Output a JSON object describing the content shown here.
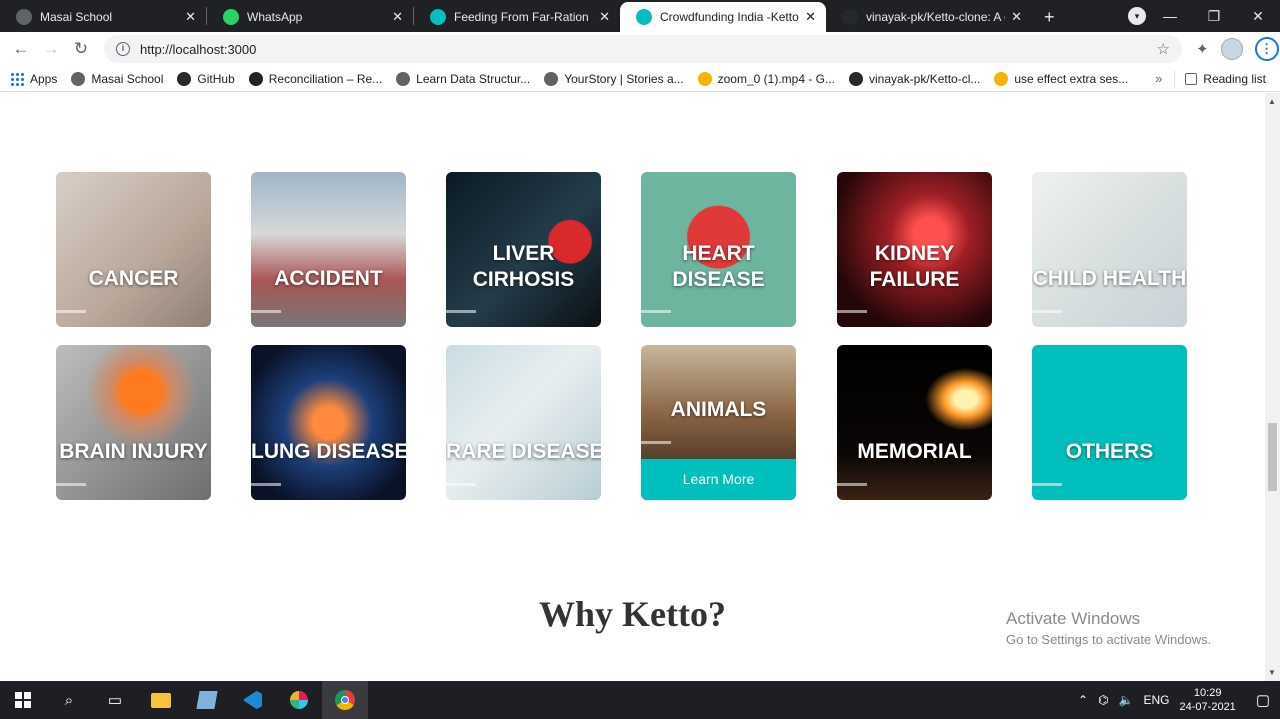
{
  "browser": {
    "tabs": [
      {
        "title": "Masai School",
        "favicon_color": "#5f6368"
      },
      {
        "title": "WhatsApp",
        "favicon_color": "#25d366"
      },
      {
        "title": "Feeding From Far-Ration Dist",
        "favicon_color": "#01bfbd"
      },
      {
        "title": "Crowdfunding India -Ketto",
        "favicon_color": "#01bfbd",
        "active": true
      },
      {
        "title": "vinayak-pk/Ketto-clone: A cl",
        "favicon_color": "#24292e"
      }
    ],
    "new_tab_icon": "plus-icon",
    "url": "http://localhost:3000",
    "bookmarks": [
      {
        "label": "Apps",
        "icon": "apps-grid-icon"
      },
      {
        "label": "Masai School",
        "icon": "globe-icon"
      },
      {
        "label": "GitHub",
        "icon": "github-icon"
      },
      {
        "label": "Reconciliation – Re...",
        "icon": "react-icon"
      },
      {
        "label": "Learn Data Structur...",
        "icon": "globe-icon"
      },
      {
        "label": "YourStory | Stories a...",
        "icon": "globe-icon"
      },
      {
        "label": "zoom_0 (1).mp4 - G...",
        "icon": "drive-icon"
      },
      {
        "label": "vinayak-pk/Ketto-cl...",
        "icon": "github-icon"
      },
      {
        "label": "use effect extra ses...",
        "icon": "drive-icon"
      }
    ],
    "bookmarks_more": "»",
    "reading_list": "Reading list"
  },
  "categories": [
    {
      "label_lines": [
        "CANCER"
      ],
      "bg": "linear-gradient(135deg,#d8cfc6,#b9a79a 60%,#8f7f74)",
      "accent": "#d9857a"
    },
    {
      "label_lines": [
        "ACCIDENT"
      ],
      "bg": "linear-gradient(180deg,#9fb6c9 0%,#d8d8d8 40%,#a55 70%,#777 100%)",
      "accent": "#e05a2b"
    },
    {
      "label_lines": [
        "LIVER",
        "CIRHOSIS"
      ],
      "bg": "radial-gradient(circle at 80% 45%,#d9292d 0 14%,transparent 15%),linear-gradient(135deg,#0a1a22,#243c4a 55%,#0a1015)",
      "accent": "#2f6de0"
    },
    {
      "label_lines": [
        "HEART",
        "DISEASE"
      ],
      "bg": "radial-gradient(circle at 50% 42%,#e0393a 0 26%,transparent 27%),#6eb5a0",
      "accent": "#e0393a"
    },
    {
      "label_lines": [
        "KIDNEY",
        "FAILURE"
      ],
      "bg": "radial-gradient(circle at 60% 40%,#ff5050 0 12%,#9e1f25 30%,#250709 75%)",
      "accent": "#ff5050"
    },
    {
      "label_lines": [
        "CHILD HEALTH"
      ],
      "bg": "linear-gradient(135deg,#eef1f0,#d7dede 55%,#c9d2d8)",
      "accent": "#d8b49a"
    },
    {
      "label_lines": [
        "BRAIN INJURY"
      ],
      "bg": "radial-gradient(circle at 55% 30%,#ff7a1e 0 14%,#d08a66 22%,transparent 40%),linear-gradient(135deg,#bdbdbd,#8e8e8e 60%,#6e6e6e)",
      "accent": "#ff7a1e"
    },
    {
      "label_lines": [
        "LUNG DISEASE"
      ],
      "bg": "radial-gradient(circle at 50% 50%,#ff8a3d 0 14%,#1d3f7a 40%,#0a1228 80%)",
      "accent": "#ff8a3d"
    },
    {
      "label_lines": [
        "RARE DISEASE"
      ],
      "bg": "linear-gradient(135deg,#c9dde3,#e8eef0 45%,#b8cdd4)",
      "accent": "#d8a5a0"
    },
    {
      "label_lines": [
        "ANIMALS"
      ],
      "bg": "linear-gradient(180deg,#c8b79c 0%,#8a6444 45%,#2b1c12 100%)",
      "accent": "#c08a5c",
      "action": "Learn More"
    },
    {
      "label_lines": [
        "MEMORIAL"
      ],
      "bg": "radial-gradient(ellipse at 83% 35%,#fff3b0 0 6%,#ff9b2a 12%,transparent 22%),linear-gradient(180deg,#000 0%,#0a0705 70%,#3a2314 100%)",
      "accent": "#ffb347"
    },
    {
      "label_lines": [
        "OTHERS"
      ],
      "bg": "#01bfbd",
      "accent": "#01bfbd"
    }
  ],
  "section_title": "Why Ketto?",
  "watermark": {
    "title": "Activate Windows",
    "subtitle": "Go to Settings to activate Windows."
  },
  "taskbar": {
    "apps": [
      "windows-start-icon",
      "search-icon",
      "task-view-icon",
      "file-explorer-icon",
      "notepad-icon",
      "vscode-icon",
      "slack-icon",
      "chrome-icon"
    ],
    "language": "ENG",
    "time": "10:29",
    "date": "24-07-2021"
  }
}
